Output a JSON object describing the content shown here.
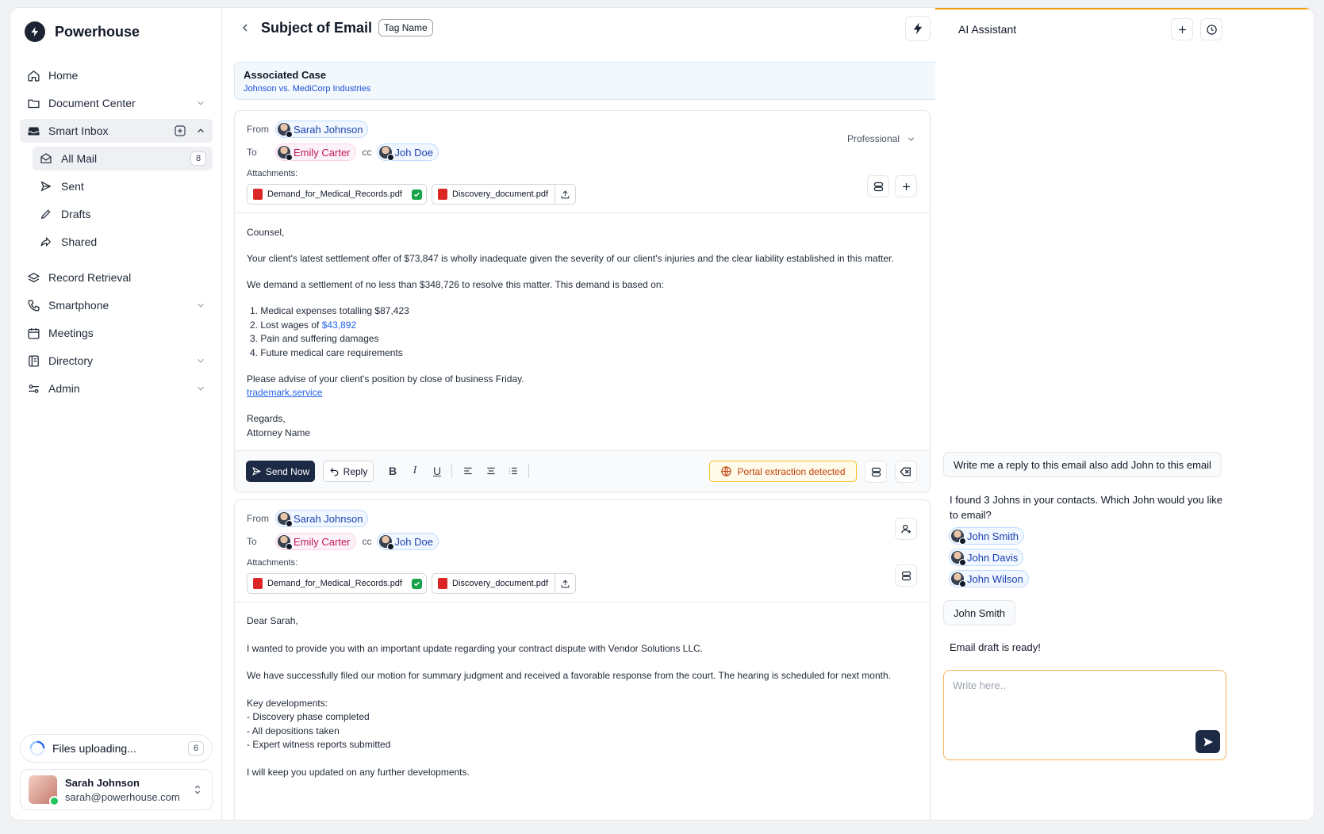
{
  "brand": {
    "name": "Powerhouse"
  },
  "nav": {
    "home": "Home",
    "document_center": "Document Center",
    "smart_inbox": "Smart Inbox",
    "all_mail": "All Mail",
    "all_mail_count": "8",
    "sent": "Sent",
    "drafts": "Drafts",
    "shared": "Shared",
    "record_retrieval": "Record Retrieval",
    "smartphone": "Smartphone",
    "meetings": "Meetings",
    "directory": "Directory",
    "admin": "Admin"
  },
  "upload": {
    "label": "Files uploading...",
    "count": "6"
  },
  "user": {
    "name": "Sarah Johnson",
    "email": "sarah@powerhouse.com"
  },
  "header": {
    "subject": "Subject of Email",
    "tag": "Tag Name"
  },
  "case": {
    "title": "Associated Case",
    "name": "Johnson vs. MediCorp Industries"
  },
  "labels": {
    "from": "From",
    "to": "To",
    "cc": "cc",
    "attachments": "Attachments:"
  },
  "email1": {
    "from": "Sarah Johnson",
    "to": "Emily Carter",
    "cc": "Joh Doe",
    "tone": "Professional",
    "attachments": [
      "Demand_for_Medical_Records.pdf",
      "Discovery_document.pdf"
    ],
    "greeting": "Counsel,",
    "p1": "Your client's latest settlement offer of $73,847 is wholly inadequate given the severity of our client's injuries and the clear liability established in this matter.",
    "p2": "We demand a settlement of no less than $348,726 to resolve this matter. This demand is based on:",
    "items": [
      "1. Medical expenses totalling $87,423",
      "2. Lost wages of ",
      "3. Pain and suffering damages",
      "4. Future medical care requirements"
    ],
    "item2_amount": "$43,892",
    "p3": "Please advise of your client's position by close of business Friday.",
    "link": "trademark.service",
    "closing": "Regards,",
    "signature": "Attorney Name",
    "send_label": "Send Now",
    "reply_label": "Reply",
    "portal_label": "Portal extraction detected"
  },
  "email2": {
    "from": "Sarah Johnson",
    "to": "Emily Carter",
    "cc": "Joh Doe",
    "attachments": [
      "Demand_for_Medical_Records.pdf",
      "Discovery_document.pdf"
    ],
    "greeting": "Dear Sarah,",
    "p1": "I wanted to provide you with an important update regarding your contract dispute with Vendor Solutions LLC.",
    "p2": "We have successfully filed our motion for summary judgment and received a favorable response from the court. The hearing is scheduled for next month.",
    "dev_title": "Key developments:",
    "devs": [
      "- Discovery phase completed",
      "- All depositions taken",
      "- Expert witness reports submitted"
    ],
    "p3": "I will keep you updated on any further developments."
  },
  "ai": {
    "title": "AI Assistant",
    "user_msg1": "Write me a reply to this email also add John to this email",
    "ai_msg1": "I found 3 Johns in your contacts. Which John would you like to email?",
    "contacts": [
      "John Smith",
      "John Davis",
      "John Wilson"
    ],
    "user_msg2": "John Smith",
    "ai_msg2": "Email draft is ready!",
    "input_placeholder": "Write here.."
  },
  "colors": {
    "accent": "#f59e0b",
    "primary": "#1c2a45",
    "link": "#2563eb"
  }
}
